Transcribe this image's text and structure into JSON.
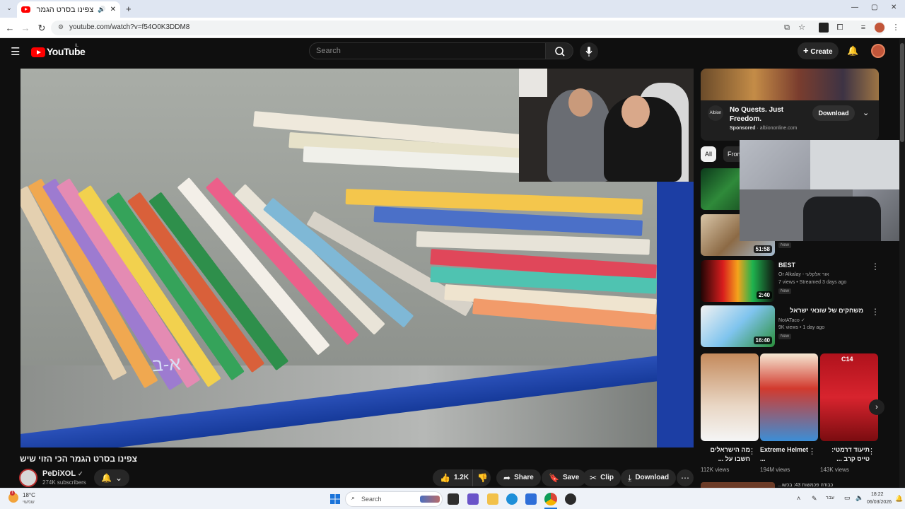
{
  "browser": {
    "tab_title": "צפינו בסרט הגמר הכי הזוי",
    "url": "youtube.com/watch?v=f54O0K3DDM8",
    "new_tab_label": "+",
    "window_controls": [
      "—",
      "▢",
      "✕"
    ]
  },
  "youtube": {
    "logo_text": "YouTube",
    "logo_region": "IL",
    "search_placeholder": "Search",
    "create_label": "Create",
    "icons": [
      "menu-icon",
      "search-icon",
      "mic-icon",
      "bell-icon",
      "account-avatar"
    ]
  },
  "video": {
    "title": "צפינו בסרט הגמר הכי הזוי שיש",
    "shelf_label": "א-ב",
    "channel_name": "PeDiXOL",
    "channel_verified": "✓",
    "subscribers": "274K subscribers",
    "like_count": "1.2K",
    "actions": {
      "share": "Share",
      "save": "Save",
      "clip": "Clip",
      "download": "Download"
    }
  },
  "ad": {
    "headline": "No Quests. Just Freedom.",
    "sponsored": "Sponsored",
    "domain": "albiononline.com",
    "brand": "Albion",
    "cta": "Download"
  },
  "chips": [
    "All",
    "From"
  ],
  "recommendations": [
    {
      "duration": "",
      "title": "",
      "channel": "",
      "meta": "",
      "badge": ""
    },
    {
      "duration": "51:58",
      "title": "",
      "channel": "",
      "meta": "",
      "badge": "New"
    },
    {
      "duration": "2:40",
      "title": "BEST",
      "channel": "Or Alkalay - אור אלקלעי",
      "meta": "7 views • Streamed 3 days ago",
      "badge": "New"
    },
    {
      "duration": "16:40",
      "title": "משחקים של שונאי ישראל",
      "channel": "NotATaco ✓",
      "meta": "9K views • 1 day ago",
      "badge": "New"
    }
  ],
  "shorts": [
    {
      "title": "מה הישראלים חשבו על ...",
      "views": "112K views"
    },
    {
      "title": "Extreme Helmet ...",
      "views": "194M views"
    },
    {
      "title": "תיעוד דרמטי: טייס קרב ...",
      "views": "143K views",
      "badge": "C14"
    }
  ],
  "next_item_title": "כבודה פכמשות 43: בכשו...",
  "taskbar": {
    "weather_temp": "18°C",
    "weather_desc": "שמשי",
    "search_label": "Search",
    "language": "עבר",
    "time": "18:22",
    "date": "06/03/2026"
  }
}
